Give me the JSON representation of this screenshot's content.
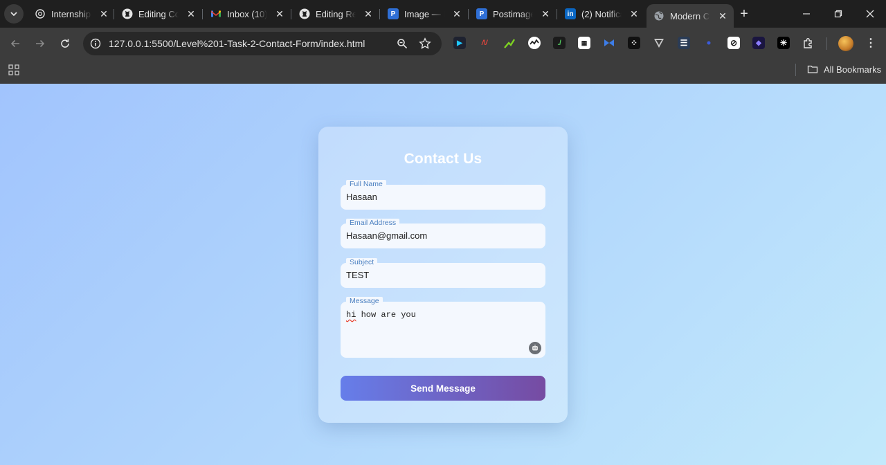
{
  "tabs": [
    {
      "title": "Internship",
      "icon": "chatgpt-icon",
      "active": false
    },
    {
      "title": "Editing Co",
      "icon": "github-icon",
      "active": false
    },
    {
      "title": "Inbox (10)",
      "icon": "gmail-icon",
      "active": false
    },
    {
      "title": "Editing Re",
      "icon": "github-icon",
      "active": false
    },
    {
      "title": "Image — P",
      "icon": "postimages-icon",
      "active": false
    },
    {
      "title": "Postimage",
      "icon": "postimages-icon",
      "active": false
    },
    {
      "title": "(2) Notifica",
      "icon": "linkedin-icon",
      "active": false
    },
    {
      "title": "Modern C",
      "icon": "globe-icon",
      "active": true
    }
  ],
  "toolbar": {
    "url": "127.0.0.1:5500/Level%201-Task-2-Contact-Form/index.html"
  },
  "bookmarks": {
    "all_label": "All Bookmarks"
  },
  "form": {
    "title": "Contact Us",
    "fields": [
      {
        "label": "Full Name",
        "value": "Hasaan"
      },
      {
        "label": "Email Address",
        "value": "Hasaan@gmail.com"
      },
      {
        "label": "Subject",
        "value": "TEST"
      },
      {
        "label": "Message",
        "value_first": "hi",
        "value_rest": " how are you"
      }
    ],
    "submit_label": "Send Message"
  },
  "colors": {
    "bg_start": "#a1c4fd",
    "bg_end": "#c2e9fb",
    "button_start": "#667eea",
    "button_end": "#764ba2",
    "label": "#4a7fc0"
  }
}
